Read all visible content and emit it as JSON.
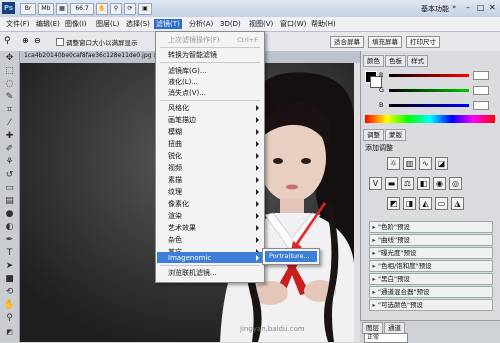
{
  "appbar": {
    "logo": "Ps",
    "zoom": "66.7",
    "workspace": "基本功能"
  },
  "menubar": {
    "items": [
      "文件(F)",
      "编辑(E)",
      "图像(I)",
      "图层(L)",
      "选择(S)",
      "滤镜(T)",
      "分析(A)",
      "3D(D)",
      "视图(V)",
      "窗口(W)",
      "帮助(H)"
    ]
  },
  "options": {
    "resize_window_label": "调整窗口大小以满屏显示",
    "fit_screen": "适合屏幕",
    "fill_screen": "填充屏幕",
    "print_size": "打印尺寸"
  },
  "document": {
    "tab_title": "1ca4b20140be0caf8fae36c128e11de0.jpg @ 66"
  },
  "filter_menu": {
    "last_filter": "上次滤镜操作(F)",
    "last_filter_shortcut": "Ctrl+F",
    "smart_filter": "转换为智能滤镜",
    "filter_gallery": "滤镜库(G)...",
    "liquify": "液化(L)...",
    "vanishing_point": "消失点(V)...",
    "groups": [
      "风格化",
      "画笔描边",
      "模糊",
      "扭曲",
      "锐化",
      "视频",
      "素描",
      "纹理",
      "像素化",
      "渲染",
      "艺术效果",
      "杂色",
      "其它"
    ],
    "imagenomic": "Imagenomic",
    "browse_online": "浏览联机滤镜..."
  },
  "submenu": {
    "portraiture": "Portraiture..."
  },
  "panels": {
    "color_tabs": [
      "颜色",
      "色板",
      "样式"
    ],
    "channels": [
      "R",
      "G",
      "B"
    ],
    "adjust_tabs": [
      "调整",
      "蒙版"
    ],
    "adjust_title": "添加调整",
    "presets": [
      "\"色阶\"预设",
      "\"曲线\"预设",
      "\"曝光度\"预设",
      "\"色相/饱和度\"预设",
      "\"黑白\"预设",
      "\"通道混合器\"预设",
      "\"可选颜色\"预设"
    ],
    "bottom_tabs": [
      "图层",
      "通道"
    ],
    "blend_mode": "正常"
  },
  "watermark": "jingyan.baidu.com",
  "colors": {
    "accent": "#3d7fd8",
    "menu_active": "#2e6bd1"
  }
}
